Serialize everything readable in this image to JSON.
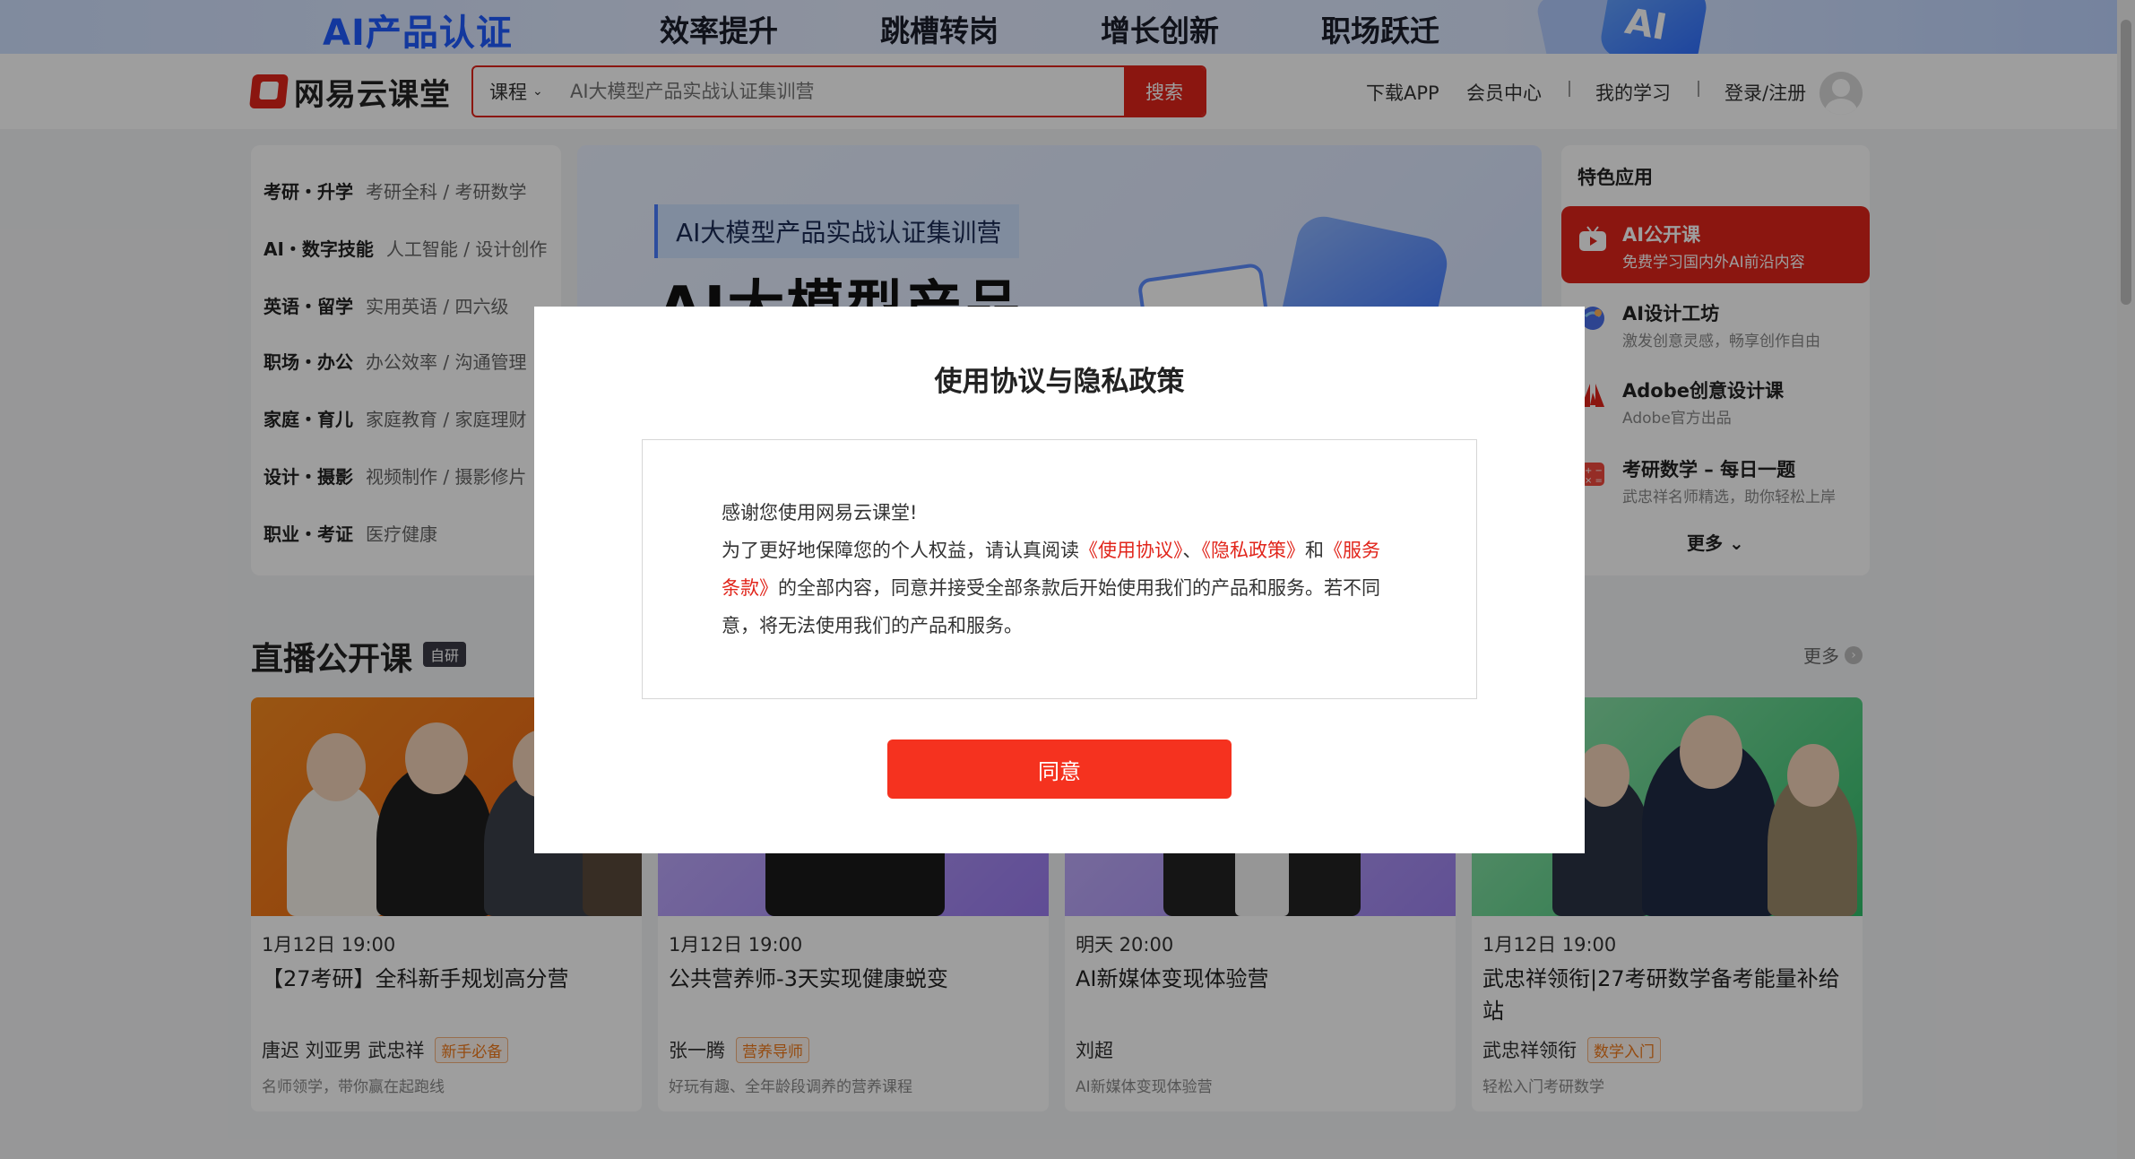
{
  "promo": {
    "title": "AI产品认证",
    "tags": [
      "效率提升",
      "跳槽转岗",
      "增长创新",
      "职场跃迁"
    ],
    "badge_text": "AI"
  },
  "header": {
    "logo_text": "网易云课堂",
    "search": {
      "category": "课程",
      "placeholder": "AI大模型产品实战认证集训营",
      "button": "搜索"
    },
    "nav": {
      "download": "下载APP",
      "vip": "会员中心",
      "my_learning": "我的学习",
      "login": "登录/注册"
    }
  },
  "categories": [
    {
      "name": "考研・升学",
      "sub": "考研全科 / 考研数学"
    },
    {
      "name": "AI・数字技能",
      "sub": "人工智能 / 设计创作"
    },
    {
      "name": "英语・留学",
      "sub": "实用英语 / 四六级"
    },
    {
      "name": "职场・办公",
      "sub": "办公效率 / 沟通管理"
    },
    {
      "name": "家庭・育儿",
      "sub": "家庭教育 / 家庭理财"
    },
    {
      "name": "设计・摄影",
      "sub": "视频制作 / 摄影修片"
    },
    {
      "name": "职业・考证",
      "sub": "医疗健康"
    }
  ],
  "banner": {
    "badge": "AI大模型产品实战认证集训营",
    "headline": "AI大模型产品"
  },
  "apps": {
    "header": "特色应用",
    "items": [
      {
        "title": "AI公开课",
        "subtitle": "免费学习国内外AI前沿内容",
        "icon": "play-tv-icon"
      },
      {
        "title": "AI设计工坊",
        "subtitle": "激发创意灵感，畅享创作自由",
        "icon": "globe-brush-icon"
      },
      {
        "title": "Adobe创意设计课",
        "subtitle": "Adobe官方出品",
        "icon": "adobe-icon"
      },
      {
        "title": "考研数学 – 每日一题",
        "subtitle": "武忠祥名师精选，助你轻松上岸",
        "icon": "calculator-icon"
      }
    ],
    "more": "更多"
  },
  "section": {
    "title": "直播公开课",
    "badge": "自研",
    "more": "更多"
  },
  "courses": [
    {
      "time": "1月12日 19:00",
      "title": "【27考研】全科新手规划高分营",
      "teachers": "唐迟 刘亚男 武忠祥",
      "tag": "新手必备",
      "desc": "名师领学，带你赢在起跑线"
    },
    {
      "time": "1月12日 19:00",
      "title": "公共营养师-3天实现健康蜕变",
      "teachers": "张一腾",
      "tag": "营养导师",
      "desc": "好玩有趣、全年龄段调养的营养课程"
    },
    {
      "time": "明天 20:00",
      "title": "AI新媒体变现体验营",
      "teachers": "刘超",
      "tag": "",
      "desc": "AI新媒体变现体验营"
    },
    {
      "time": "1月12日 19:00",
      "title": "武忠祥领衔|27考研数学备考能量补给站",
      "teachers": "武忠祥领衔",
      "tag": "数学入门",
      "desc": "轻松入门考研数学"
    }
  ],
  "modal": {
    "title": "使用协议与隐私政策",
    "greeting": "感谢您使用网易云课堂!",
    "text_1": "为了更好地保障您的个人权益，请认真阅读",
    "link_agreement": "《使用协议》",
    "sep": "、",
    "link_privacy": "《隐私政策》",
    "and": "和",
    "link_terms": "《服务条款》",
    "text_2": "的全部内容，同意并接受全部条款后开始使用我们的产品和服务。若不同意，将无法使用我们的产品和服务。",
    "agree_button": "同意"
  },
  "colors": {
    "brand_red": "#e1251b",
    "agree_red": "#f5321f",
    "promo_blue": "#1f5bff"
  }
}
